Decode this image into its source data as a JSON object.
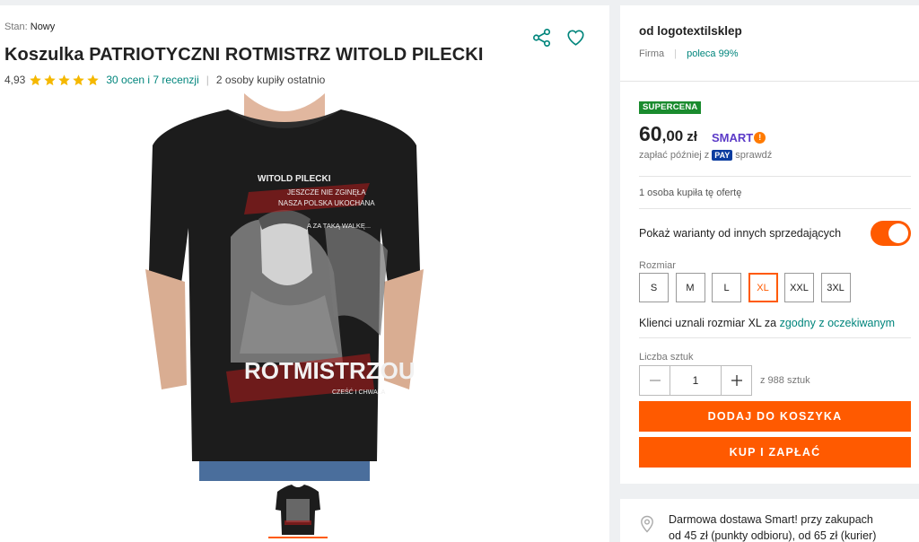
{
  "product": {
    "condition_label": "Stan:",
    "condition_value": "Nowy",
    "title": "Koszulka PATRIOTYCZNI ROTMISTRZ WITOLD PILECKI",
    "rating": "4,93",
    "stars": 5,
    "reviews_link": "30 ocen i 7 recenzji",
    "recent_buyers": "2 osoby kupiły ostatnio"
  },
  "seller": {
    "name": "od logotextilsklep",
    "type": "Firma",
    "recommend": "poleca 99%"
  },
  "offer": {
    "badge": "SUPERCENA",
    "price_main": "60",
    "price_cents": ",00",
    "currency": "zł",
    "smart_label": "SMART",
    "pay_later_prefix": "zapłać później z",
    "pay_badge": "PAY",
    "pay_check": "sprawdź",
    "bought_count": "1 osoba kupiła tę ofertę"
  },
  "variants": {
    "toggle_label": "Pokaż warianty od innych sprzedających",
    "toggle_on": true,
    "size_label": "Rozmiar",
    "sizes": [
      "S",
      "M",
      "L",
      "XL",
      "XXL",
      "3XL"
    ],
    "selected_size": "XL",
    "fit_prefix": "Klienci uznali rozmiar XL za",
    "fit_link": "zgodny z oczekiwanym"
  },
  "quantity": {
    "label": "Liczba sztuk",
    "value": "1",
    "available": "z 988 sztuk"
  },
  "buttons": {
    "add_to_cart": "DODAJ DO KOSZYKA",
    "buy_now": "KUP I ZAPŁAĆ"
  },
  "delivery": {
    "line1": "Darmowa dostawa Smart! przy zakupach",
    "line2": "od 45 zł (punkty odbioru), od 65 zł (kurier)"
  },
  "shirt_print": {
    "name": "WITOLD PILECKI",
    "line1": "JESZCZE NIE ZGINĘŁA",
    "line2": "NASZA POLSKA UKOCHANA",
    "line3": "A ZA TAKĄ WALKĘ...",
    "big": "ROTMISTRZOU",
    "small": "CZEŚĆ I CHWAŁA"
  },
  "colors": {
    "accent": "#ff5a00",
    "link": "#00857c",
    "badge": "#1a8b2e",
    "smart": "#5c3bc8"
  }
}
